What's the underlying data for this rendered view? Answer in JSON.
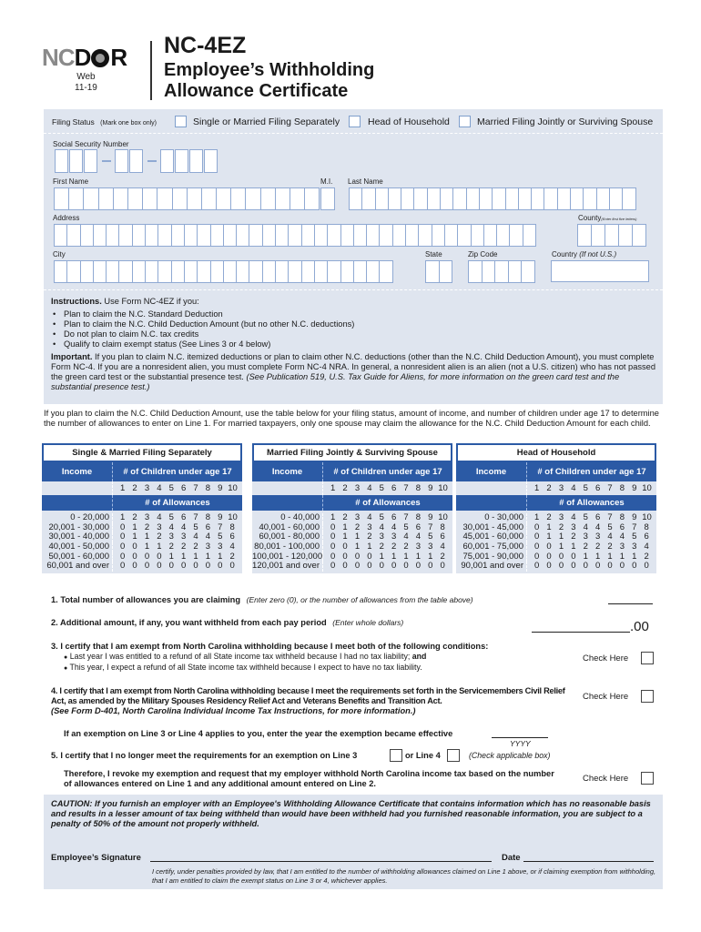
{
  "header": {
    "logo_nc": "NC",
    "logo_d": "D",
    "logo_r": "R",
    "logo_sub1": "Web",
    "logo_sub2": "11-19",
    "form_number": "NC-4EZ",
    "title_line1": "Employee’s Withholding",
    "title_line2": "Allowance Certificate"
  },
  "filing_status": {
    "label": "Filing Status",
    "hint": "(Mark one box only)",
    "options": [
      {
        "label": "Single or Married Filing Separately",
        "checked": false
      },
      {
        "label": "Head of Household",
        "checked": false
      },
      {
        "label": "Married Filing Jointly or Surviving Spouse",
        "checked": false
      }
    ]
  },
  "fields": {
    "ssn_label": "Social Security Number",
    "first_name_label": "First Name",
    "mi_label": "M.I.",
    "last_name_label": "Last Name",
    "address_label": "Address",
    "county_label": "County",
    "county_hint": "(Enter first five letters)",
    "city_label": "City",
    "state_label": "State",
    "zip_label": "Zip Code",
    "country_label": "Country",
    "country_hint": "(If not U.S.)"
  },
  "instructions": {
    "heading": "Instructions.",
    "heading_rest": "Use Form NC-4EZ if you:",
    "bullets": [
      "Plan to claim the N.C. Standard Deduction",
      "Plan to claim the N.C. Child Deduction Amount (but no other N.C. deductions)",
      "Do not plan to claim N.C. tax credits",
      "Qualify to claim exempt status (See Lines 3 or 4 below)"
    ],
    "important_label": "Important.",
    "important_text": "If you plan to claim N.C. itemized deductions or plan to claim other N.C. deductions (other than the N.C. Child Deduction Amount), you must complete Form NC-4. If you are a nonresident alien, you must complete Form NC-4 NRA. In general, a nonresident alien is an alien (not a U.S. citizen) who has not passed the green card test or the substantial presence test.",
    "important_italic": "(See Publication 519, U.S. Tax Guide for Aliens, for more information on the green card test and the substantial presence test.)"
  },
  "intro_text": "If you plan to claim the N.C. Child Deduction Amount, use the table below for your filing status, amount of income, and number of children under age 17 to determine the number of allowances to enter on Line 1. For married taxpayers, only one spouse may claim the allowance for the N.C. Child Deduction Amount for each child.",
  "tables": {
    "income_header": "Income",
    "children_header": "# of Children under age 17",
    "allowances_header": "# of Allowances",
    "children": [
      "1",
      "2",
      "3",
      "4",
      "5",
      "6",
      "7",
      "8",
      "9",
      "10"
    ],
    "list": [
      {
        "title": "Single & Married Filing Separately",
        "rows": [
          {
            "income": "0 - 20,000",
            "values": [
              "1",
              "2",
              "3",
              "4",
              "5",
              "6",
              "7",
              "8",
              "9",
              "10"
            ]
          },
          {
            "income": "20,001 - 30,000",
            "values": [
              "0",
              "1",
              "2",
              "3",
              "4",
              "4",
              "5",
              "6",
              "7",
              "8"
            ]
          },
          {
            "income": "30,001 - 40,000",
            "values": [
              "0",
              "1",
              "1",
              "2",
              "3",
              "3",
              "4",
              "4",
              "5",
              "6"
            ]
          },
          {
            "income": "40,001 - 50,000",
            "values": [
              "0",
              "0",
              "1",
              "1",
              "2",
              "2",
              "2",
              "3",
              "3",
              "4"
            ]
          },
          {
            "income": "50,001 - 60,000",
            "values": [
              "0",
              "0",
              "0",
              "0",
              "1",
              "1",
              "1",
              "1",
              "1",
              "2"
            ]
          },
          {
            "income": "60,001 and over",
            "values": [
              "0",
              "0",
              "0",
              "0",
              "0",
              "0",
              "0",
              "0",
              "0",
              "0"
            ]
          }
        ]
      },
      {
        "title": "Married Filing Jointly & Surviving Spouse",
        "rows": [
          {
            "income": "0 - 40,000",
            "values": [
              "1",
              "2",
              "3",
              "4",
              "5",
              "6",
              "7",
              "8",
              "9",
              "10"
            ]
          },
          {
            "income": "40,001 - 60,000",
            "values": [
              "0",
              "1",
              "2",
              "3",
              "4",
              "4",
              "5",
              "6",
              "7",
              "8"
            ]
          },
          {
            "income": "60,001 - 80,000",
            "values": [
              "0",
              "1",
              "1",
              "2",
              "3",
              "3",
              "4",
              "4",
              "5",
              "6"
            ]
          },
          {
            "income": "80,001 - 100,000",
            "values": [
              "0",
              "0",
              "1",
              "1",
              "2",
              "2",
              "2",
              "3",
              "3",
              "4"
            ]
          },
          {
            "income": "100,001 - 120,000",
            "values": [
              "0",
              "0",
              "0",
              "0",
              "1",
              "1",
              "1",
              "1",
              "1",
              "2"
            ]
          },
          {
            "income": "120,001 and over",
            "values": [
              "0",
              "0",
              "0",
              "0",
              "0",
              "0",
              "0",
              "0",
              "0",
              "0"
            ]
          }
        ]
      },
      {
        "title": "Head of Household",
        "rows": [
          {
            "income": "0 - 30,000",
            "values": [
              "1",
              "2",
              "3",
              "4",
              "5",
              "6",
              "7",
              "8",
              "9",
              "10"
            ]
          },
          {
            "income": "30,001 - 45,000",
            "values": [
              "0",
              "1",
              "2",
              "3",
              "4",
              "4",
              "5",
              "6",
              "7",
              "8"
            ]
          },
          {
            "income": "45,001 - 60,000",
            "values": [
              "0",
              "1",
              "1",
              "2",
              "3",
              "3",
              "4",
              "4",
              "5",
              "6"
            ]
          },
          {
            "income": "60,001 - 75,000",
            "values": [
              "0",
              "0",
              "1",
              "1",
              "2",
              "2",
              "2",
              "3",
              "3",
              "4"
            ]
          },
          {
            "income": "75,001 - 90,000",
            "values": [
              "0",
              "0",
              "0",
              "0",
              "1",
              "1",
              "1",
              "1",
              "1",
              "2"
            ]
          },
          {
            "income": "90,001 and over",
            "values": [
              "0",
              "0",
              "0",
              "0",
              "0",
              "0",
              "0",
              "0",
              "0",
              "0"
            ]
          }
        ]
      }
    ]
  },
  "lines": {
    "l1_bold": "1. Total number of allowances you are claiming",
    "l1_hint": "(Enter zero (0), or the number of allowances from the table above)",
    "l1_value": "",
    "l2_bold": "2. Additional amount, if any, you want withheld from each pay period",
    "l2_hint": "(Enter whole dollars)",
    "l2_value": "",
    "l2_cents": ".00",
    "l3_bold": "3. I certify that I am exempt from North Carolina withholding because I meet both of the following conditions:",
    "l3_b1": "Last year I was entitled to a refund of all State income tax withheld because I had no tax liability;",
    "l3_b1_and": "and",
    "l3_b2": "This year, I expect a refund of all State income tax withheld because I expect to have no tax liability.",
    "l4_bold": "4. I certify that I am exempt from North Carolina withholding because I meet the requirements set forth in the Servicemembers Civil Relief Act, as amended by the Military Spouses Residency Relief Act and Veterans Benefits and Transition Act.",
    "l4_italic": "(See Form D-401, North Carolina Individual Income Tax Instructions, for more information.)",
    "year_text": "If an exemption on Line 3 or Line 4 applies to you, enter the year the exemption became effective",
    "year_hint": "YYYY",
    "l5_bold": "5. I certify that I no longer meet the requirements for an exemption on Line 3",
    "l5_or": "or Line 4",
    "l5_hint": "(Check applicable box)",
    "l5_revoke": "Therefore, I revoke my exemption and request that my employer withhold North Carolina income tax based on the number of allowances entered on Line 1 and any additional amount entered on Line 2.",
    "check_here": "Check Here"
  },
  "caution": "CAUTION: If you furnish an employer with an Employee's Withholding Allowance Certificate that contains information which has no reasonable basis and results in a lesser amount of tax being withheld than would have been withheld had you furnished reasonable information, you are subject to a penalty of 50% of the amount not properly withheld.",
  "signature": {
    "label": "Employee’s Signature",
    "date_label": "Date",
    "certify": "I certify, under penalties provided by law, that I am entitled to the number of withholding allowances claimed on Line 1 above, or if claiming exemption from withholding, that I am entitled to claim the exempt status on Line 3 or 4, whichever applies."
  }
}
